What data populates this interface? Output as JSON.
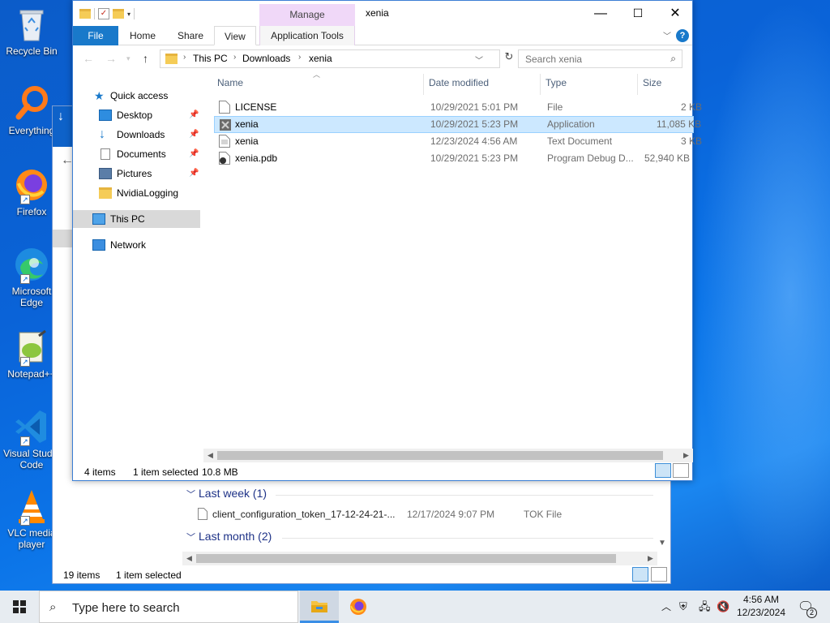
{
  "desktop": {
    "icons": [
      {
        "label": "Recycle Bin",
        "icon": "recycle-bin-icon"
      },
      {
        "label": "Everything",
        "icon": "everything-search-icon"
      },
      {
        "label": "Firefox",
        "icon": "firefox-icon"
      },
      {
        "label": "Microsoft Edge",
        "icon": "edge-icon"
      },
      {
        "label": "Notepad++",
        "icon": "notepad-plus-plus-icon"
      },
      {
        "label": "Visual Studio Code",
        "icon": "vscode-icon"
      },
      {
        "label": "VLC media player",
        "icon": "vlc-icon"
      }
    ]
  },
  "back_window": {
    "groups": [
      {
        "label": "Last week (1)"
      },
      {
        "label": "Last month (2)"
      }
    ],
    "row": {
      "name": "client_configuration_token_17-12-24-21-...",
      "date": "12/17/2024 9:07 PM",
      "type": "TOK File"
    },
    "status": {
      "items": "19 items",
      "selected": "1 item selected"
    }
  },
  "window": {
    "title": "xenia",
    "manage_label": "Manage",
    "tabs": {
      "file": "File",
      "home": "Home",
      "share": "Share",
      "view": "View",
      "app_tools": "Application Tools"
    },
    "help_label": "?",
    "breadcrumb": [
      "This PC",
      "Downloads",
      "xenia"
    ],
    "search_placeholder": "Search xenia",
    "nav": {
      "quick_access": "Quick access",
      "desktop": "Desktop",
      "downloads": "Downloads",
      "documents": "Documents",
      "pictures": "Pictures",
      "nvidia": "NvidiaLogging",
      "this_pc": "This PC",
      "network": "Network"
    },
    "columns": {
      "name": "Name",
      "date": "Date modified",
      "type": "Type",
      "size": "Size"
    },
    "files": [
      {
        "name": "LICENSE",
        "date": "10/29/2021 5:01 PM",
        "type": "File",
        "size": "2 KB"
      },
      {
        "name": "xenia",
        "date": "10/29/2021 5:23 PM",
        "type": "Application",
        "size": "11,085 KB"
      },
      {
        "name": "xenia",
        "date": "12/23/2024 4:56 AM",
        "type": "Text Document",
        "size": "3 KB"
      },
      {
        "name": "xenia.pdb",
        "date": "10/29/2021 5:23 PM",
        "type": "Program Debug D...",
        "size": "52,940 KB"
      }
    ],
    "status": {
      "items": "4 items",
      "selected": "1 item selected",
      "size": "10.8 MB"
    }
  },
  "taskbar": {
    "search_placeholder": "Type here to search",
    "time": "4:56 AM",
    "date": "12/23/2024",
    "notifications": "2"
  },
  "colors": {
    "accent": "#1979ca",
    "selection": "#cce8ff",
    "manage": "#f0d8f8"
  }
}
